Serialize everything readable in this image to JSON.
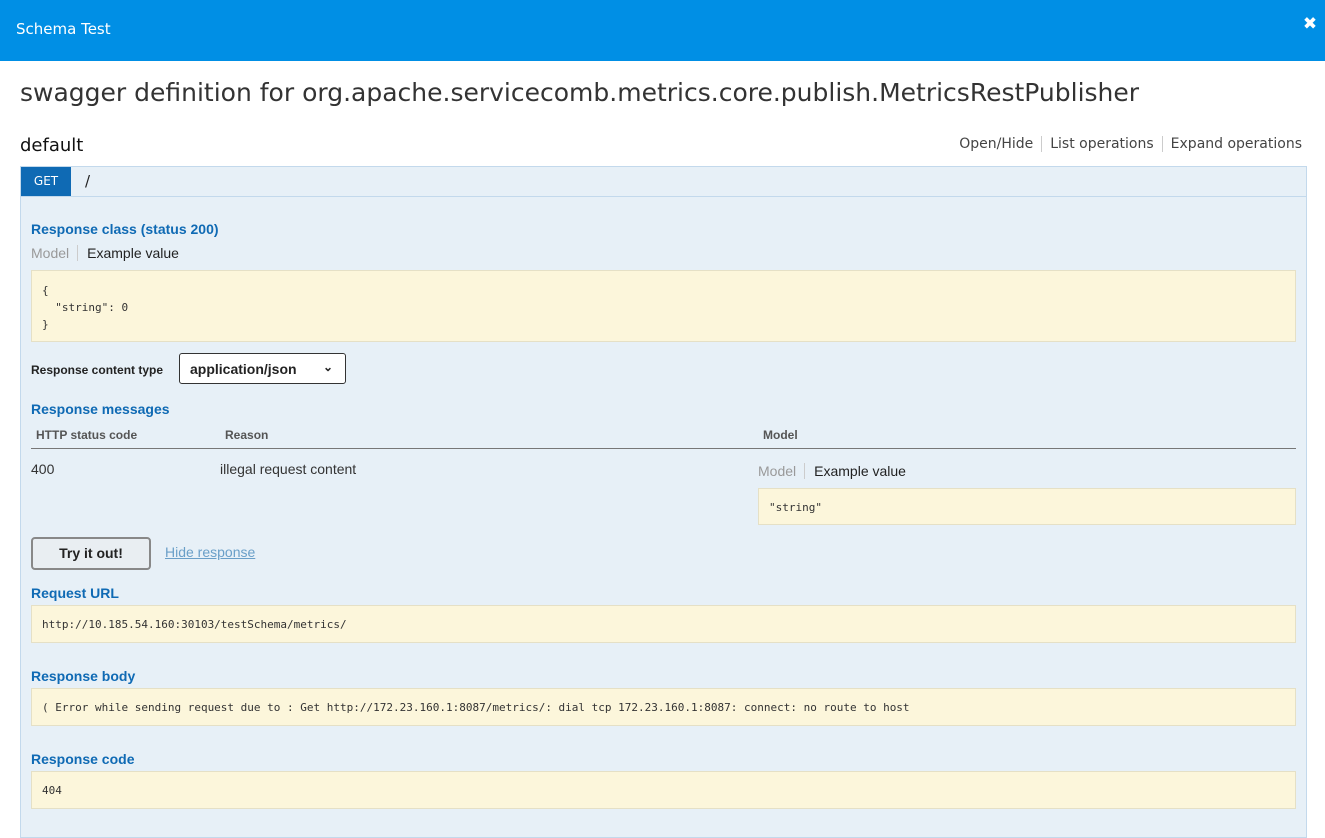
{
  "header": {
    "title": "Schema Test",
    "close_icon": "close-icon"
  },
  "page": {
    "title": "swagger definition for org.apache.servicecomb.metrics.core.publish.MetricsRestPublisher"
  },
  "resource": {
    "name": "default",
    "links": [
      "Open/Hide",
      "List operations",
      "Expand operations"
    ]
  },
  "operation": {
    "method": "GET",
    "path": "/",
    "response_class_title": "Response class (status 200)",
    "model_tab": "Model",
    "example_tab": "Example value",
    "response_example": "{\n  \"string\": 0\n}",
    "content_type_label": "Response content type",
    "content_type_value": "application/json",
    "messages_title": "Response messages",
    "messages_headers": [
      "HTTP status code",
      "Reason",
      "Model"
    ],
    "messages_rows": [
      {
        "status": "400",
        "reason": "illegal request content",
        "model_tab": "Model",
        "example_tab": "Example value",
        "example": "\"string\""
      }
    ],
    "try_button": "Try it out!",
    "hide_response": "Hide response",
    "request_url_title": "Request URL",
    "request_url": "http://10.185.54.160:30103/testSchema/metrics/",
    "response_body_title": "Response body",
    "response_body": "( Error while sending request due to : Get http://172.23.160.1:8087/metrics/: dial tcp 172.23.160.1:8087: connect: no route to host",
    "response_code_title": "Response code",
    "response_code": "404"
  },
  "colors": {
    "header_bg": "#008fe5",
    "get_badge": "#0f6ab4",
    "section_bg": "#e7f0f7",
    "code_bg": "#fcf6db"
  }
}
